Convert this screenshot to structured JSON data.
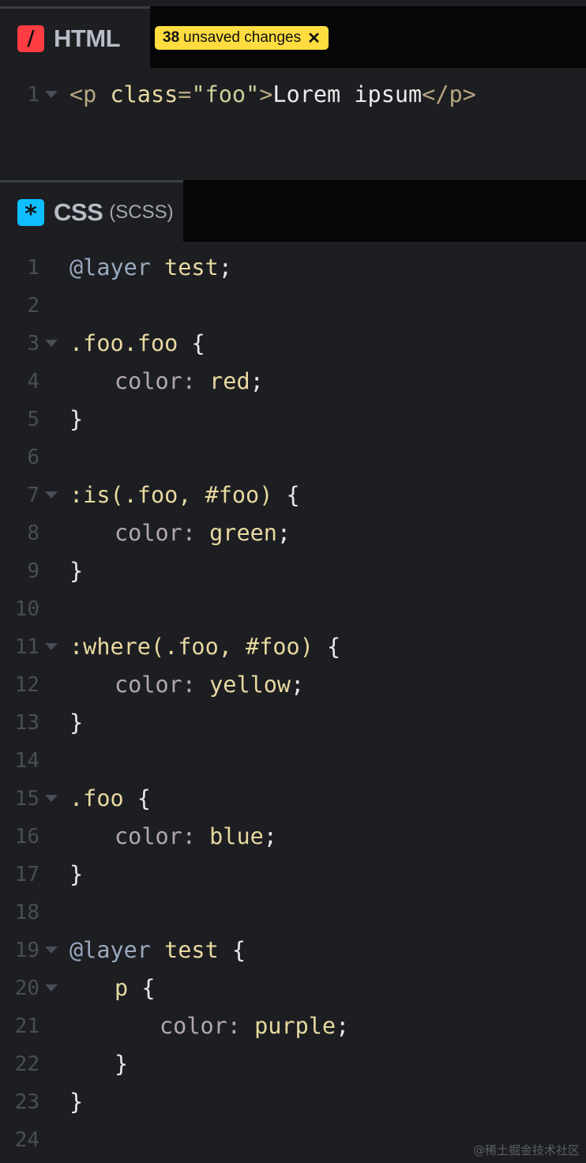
{
  "html_pane": {
    "title": "HTML",
    "icon": "slash-icon",
    "icon_glyph": "/",
    "icon_color": "#ff3c41",
    "badge": {
      "count": "38",
      "text": "unsaved changes",
      "close_glyph": "✕",
      "color": "#ffdd40"
    },
    "lines": [
      {
        "num": "1",
        "fold": true,
        "tokens": [
          {
            "t": "<p ",
            "c": "tag"
          },
          {
            "t": "class",
            "c": "attr"
          },
          {
            "t": "=",
            "c": "tag"
          },
          {
            "t": "\"foo\"",
            "c": "str"
          },
          {
            "t": ">",
            "c": "tag"
          },
          {
            "t": "Lorem ipsum",
            "c": "text"
          },
          {
            "t": "</p>",
            "c": "tag"
          }
        ]
      }
    ]
  },
  "css_pane": {
    "title": "CSS",
    "subtitle": "(SCSS)",
    "icon": "asterisk-icon",
    "icon_glyph": "*",
    "icon_color": "#0ebeff",
    "lines": [
      {
        "num": "1",
        "fold": false,
        "indent": 0,
        "tokens": [
          {
            "t": "@layer",
            "c": "atrule"
          },
          {
            "t": " test",
            "c": "sel"
          },
          {
            "t": ";",
            "c": "punc"
          }
        ]
      },
      {
        "num": "2",
        "fold": false,
        "indent": 0,
        "tokens": []
      },
      {
        "num": "3",
        "fold": true,
        "indent": 0,
        "tokens": [
          {
            "t": ".foo.foo",
            "c": "sel"
          },
          {
            "t": " {",
            "c": "punc"
          }
        ]
      },
      {
        "num": "4",
        "fold": false,
        "indent": 1,
        "tokens": [
          {
            "t": "color",
            "c": "prop"
          },
          {
            "t": ": ",
            "c": "prop"
          },
          {
            "t": "red",
            "c": "val"
          },
          {
            "t": ";",
            "c": "punc"
          }
        ]
      },
      {
        "num": "5",
        "fold": false,
        "indent": 0,
        "tokens": [
          {
            "t": "}",
            "c": "punc"
          }
        ]
      },
      {
        "num": "6",
        "fold": false,
        "indent": 0,
        "tokens": []
      },
      {
        "num": "7",
        "fold": true,
        "indent": 0,
        "tokens": [
          {
            "t": ":is(.foo, #foo)",
            "c": "sel"
          },
          {
            "t": " {",
            "c": "punc"
          }
        ]
      },
      {
        "num": "8",
        "fold": false,
        "indent": 1,
        "tokens": [
          {
            "t": "color",
            "c": "prop"
          },
          {
            "t": ": ",
            "c": "prop"
          },
          {
            "t": "green",
            "c": "val"
          },
          {
            "t": ";",
            "c": "punc"
          }
        ]
      },
      {
        "num": "9",
        "fold": false,
        "indent": 0,
        "tokens": [
          {
            "t": "}",
            "c": "punc"
          }
        ]
      },
      {
        "num": "10",
        "fold": false,
        "indent": 0,
        "tokens": []
      },
      {
        "num": "11",
        "fold": true,
        "indent": 0,
        "tokens": [
          {
            "t": ":where(.foo, #foo)",
            "c": "sel"
          },
          {
            "t": " {",
            "c": "punc"
          }
        ]
      },
      {
        "num": "12",
        "fold": false,
        "indent": 1,
        "tokens": [
          {
            "t": "color",
            "c": "prop"
          },
          {
            "t": ": ",
            "c": "prop"
          },
          {
            "t": "yellow",
            "c": "val"
          },
          {
            "t": ";",
            "c": "punc"
          }
        ]
      },
      {
        "num": "13",
        "fold": false,
        "indent": 0,
        "tokens": [
          {
            "t": "}",
            "c": "punc"
          }
        ]
      },
      {
        "num": "14",
        "fold": false,
        "indent": 0,
        "tokens": []
      },
      {
        "num": "15",
        "fold": true,
        "indent": 0,
        "tokens": [
          {
            "t": ".foo",
            "c": "sel"
          },
          {
            "t": " {",
            "c": "punc"
          }
        ]
      },
      {
        "num": "16",
        "fold": false,
        "indent": 1,
        "tokens": [
          {
            "t": "color",
            "c": "prop"
          },
          {
            "t": ": ",
            "c": "prop"
          },
          {
            "t": "blue",
            "c": "val"
          },
          {
            "t": ";",
            "c": "punc"
          }
        ]
      },
      {
        "num": "17",
        "fold": false,
        "indent": 0,
        "tokens": [
          {
            "t": "}",
            "c": "punc"
          }
        ]
      },
      {
        "num": "18",
        "fold": false,
        "indent": 0,
        "tokens": []
      },
      {
        "num": "19",
        "fold": true,
        "indent": 0,
        "tokens": [
          {
            "t": "@layer",
            "c": "atrule"
          },
          {
            "t": " test",
            "c": "sel"
          },
          {
            "t": " {",
            "c": "punc"
          }
        ]
      },
      {
        "num": "20",
        "fold": true,
        "indent": 1,
        "tokens": [
          {
            "t": "p",
            "c": "sel"
          },
          {
            "t": " {",
            "c": "punc"
          }
        ]
      },
      {
        "num": "21",
        "fold": false,
        "indent": 2,
        "tokens": [
          {
            "t": "color",
            "c": "prop"
          },
          {
            "t": ": ",
            "c": "prop"
          },
          {
            "t": "purple",
            "c": "val"
          },
          {
            "t": ";",
            "c": "punc"
          }
        ]
      },
      {
        "num": "22",
        "fold": false,
        "indent": 1,
        "tokens": [
          {
            "t": "}",
            "c": "punc"
          }
        ]
      },
      {
        "num": "23",
        "fold": false,
        "indent": 0,
        "tokens": [
          {
            "t": "}",
            "c": "punc"
          }
        ]
      },
      {
        "num": "24",
        "fold": false,
        "indent": 0,
        "tokens": []
      }
    ]
  },
  "watermark": "@稀土掘金技术社区"
}
